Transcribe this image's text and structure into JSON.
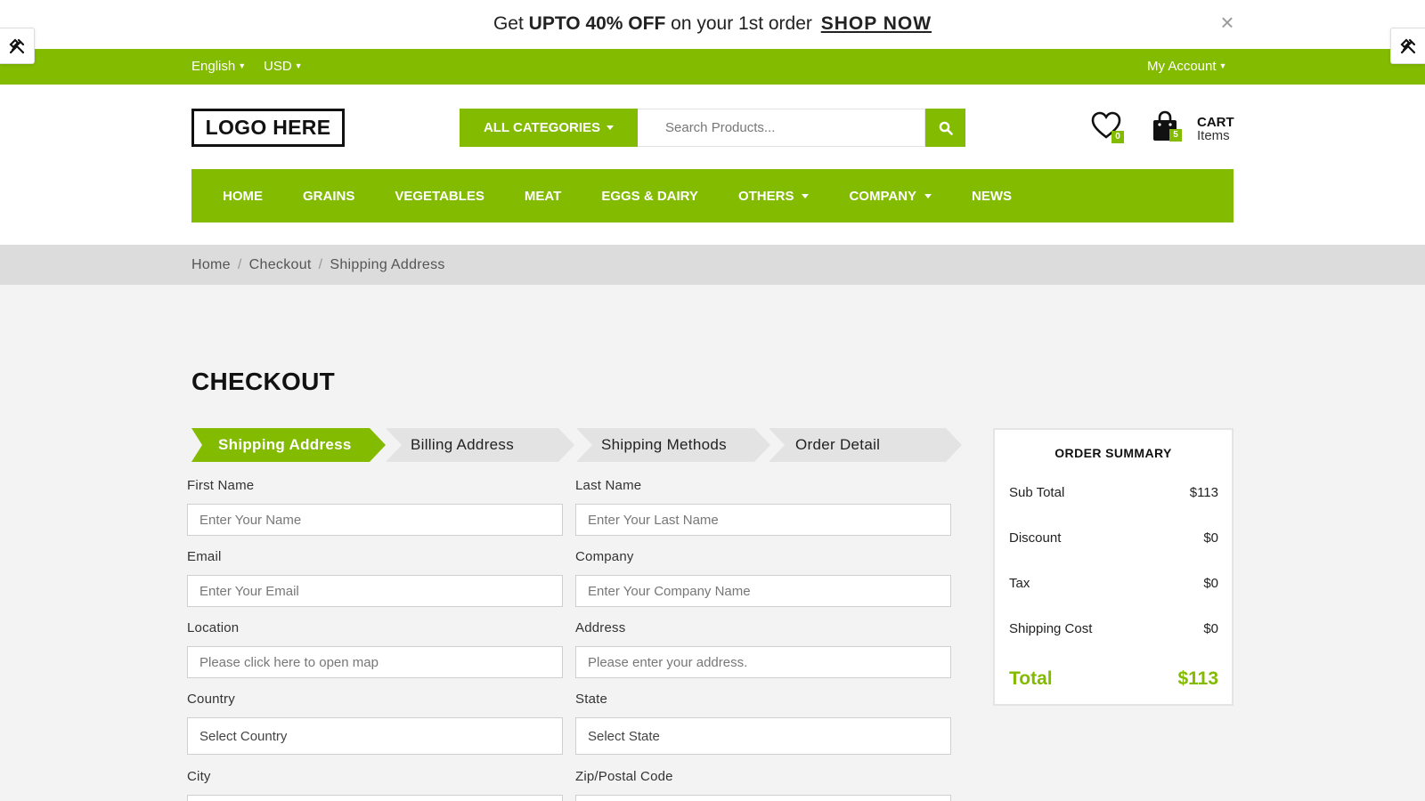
{
  "promo": {
    "prefix": "Get ",
    "highlight": "UPTO 40% OFF",
    "middle": " on your 1st order ",
    "link": "SHOP NOW",
    "close": "×"
  },
  "topbar": {
    "language": "English",
    "currency": "USD",
    "account": "My Account"
  },
  "header": {
    "logo": "LOGO HERE",
    "categories_button": "ALL CATEGORIES",
    "search_placeholder": "Search Products...",
    "wishlist_count": "0",
    "cart_count": "5",
    "cart_label": "CART",
    "cart_sublabel": "Items"
  },
  "nav": {
    "items": [
      {
        "label": "HOME"
      },
      {
        "label": "GRAINS"
      },
      {
        "label": "VEGETABLES"
      },
      {
        "label": "MEAT"
      },
      {
        "label": "EGGS & DAIRY"
      },
      {
        "label": "OTHERS"
      },
      {
        "label": "COMPANY"
      },
      {
        "label": "NEWS"
      }
    ]
  },
  "breadcrumb": {
    "items": [
      "Home",
      "Checkout",
      "Shipping Address"
    ],
    "separator": "/"
  },
  "checkout": {
    "title": "CHECKOUT",
    "steps": [
      "Shipping Address",
      "Billing Address",
      "Shipping Methods",
      "Order Detail"
    ],
    "fields": {
      "first_name": {
        "label": "First Name",
        "placeholder": "Enter Your Name"
      },
      "last_name": {
        "label": "Last Name",
        "placeholder": "Enter Your Last Name"
      },
      "email": {
        "label": "Email",
        "placeholder": "Enter Your Email"
      },
      "company": {
        "label": "Company",
        "placeholder": "Enter Your Company Name"
      },
      "location": {
        "label": "Location",
        "placeholder": "Please click here to open map"
      },
      "address": {
        "label": "Address",
        "placeholder": "Please enter your address."
      },
      "country": {
        "label": "Country",
        "value": "Select Country"
      },
      "state": {
        "label": "State",
        "value": "Select State"
      },
      "city": {
        "label": "City"
      },
      "zip": {
        "label": "Zip/Postal Code"
      }
    }
  },
  "summary": {
    "title": "ORDER SUMMARY",
    "rows": [
      {
        "label": "Sub Total",
        "value": "$113"
      },
      {
        "label": "Discount",
        "value": "$0"
      },
      {
        "label": "Tax",
        "value": "$0"
      },
      {
        "label": "Shipping Cost",
        "value": "$0"
      }
    ],
    "total_label": "Total",
    "total_value": "$113"
  },
  "colors": {
    "brand_green": "#82bb00",
    "breadcrumb_bg": "#dcdcdc",
    "page_bg": "#f3f3f3"
  }
}
